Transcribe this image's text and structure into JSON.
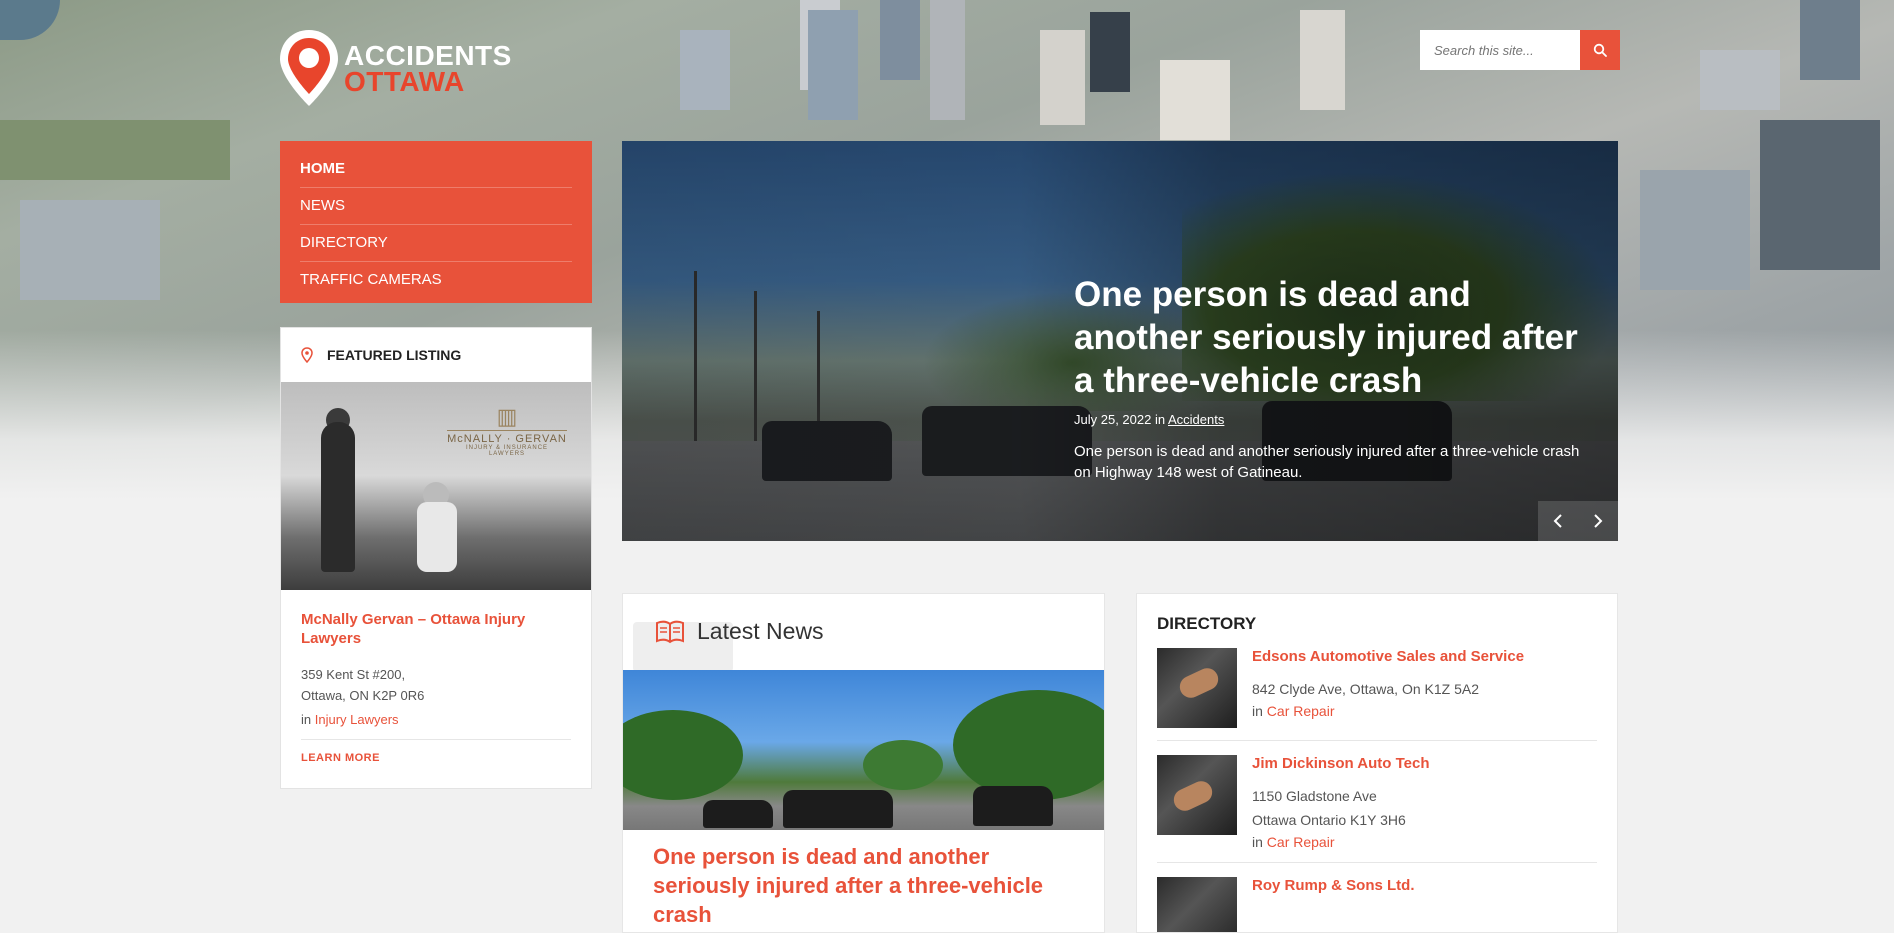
{
  "site": {
    "logo_line1": "ACCIDENTS",
    "logo_line2": "OTTAWA",
    "accent_color": "#e8523a"
  },
  "search": {
    "placeholder": "Search this site...",
    "icon": "search-icon"
  },
  "nav": {
    "items": [
      {
        "label": "HOME",
        "active": true
      },
      {
        "label": "NEWS"
      },
      {
        "label": "DIRECTORY"
      },
      {
        "label": "TRAFFIC CAMERAS"
      }
    ]
  },
  "featured": {
    "heading": "FEATURED LISTING",
    "icon": "map-pin-icon",
    "brand_mark": "McNALLY · GERVAN",
    "brand_sub": "INJURY & INSURANCE LAWYERS",
    "title": "McNally Gervan – Ottawa Injury Lawyers",
    "address_line1": "359 Kent St #200,",
    "address_line2": "Ottawa, ON K2P 0R6",
    "category_prefix": "in",
    "category": "Injury Lawyers",
    "learn_more": "LEARN MORE"
  },
  "slider": {
    "title": "One person is dead and another seriously injured after a three-vehicle crash",
    "date": "July 25, 2022",
    "in_label": "in",
    "category": "Accidents",
    "excerpt": "One person is dead and another seriously injured after a three-vehicle crash on Highway 148 west of Gatineau.",
    "prev_icon": "chevron-left-icon",
    "next_icon": "chevron-right-icon"
  },
  "latest_news": {
    "heading": "Latest News",
    "icon": "book-icon",
    "article_title": "One person is dead and another seriously injured after a three-vehicle crash"
  },
  "directory": {
    "heading": "DIRECTORY",
    "entries": [
      {
        "name": "Edsons Automotive Sales and Service",
        "address": "842 Clyde Ave, Ottawa, On K1Z 5A2",
        "address2": "",
        "category_prefix": "in",
        "category": "Car Repair"
      },
      {
        "name": "Jim Dickinson Auto Tech",
        "address": "1150 Gladstone Ave",
        "address2": "Ottawa Ontario K1Y 3H6",
        "category_prefix": "in",
        "category": "Car Repair"
      },
      {
        "name": "Roy Rump & Sons Ltd.",
        "address": "",
        "address2": "",
        "category_prefix": "",
        "category": ""
      }
    ]
  }
}
